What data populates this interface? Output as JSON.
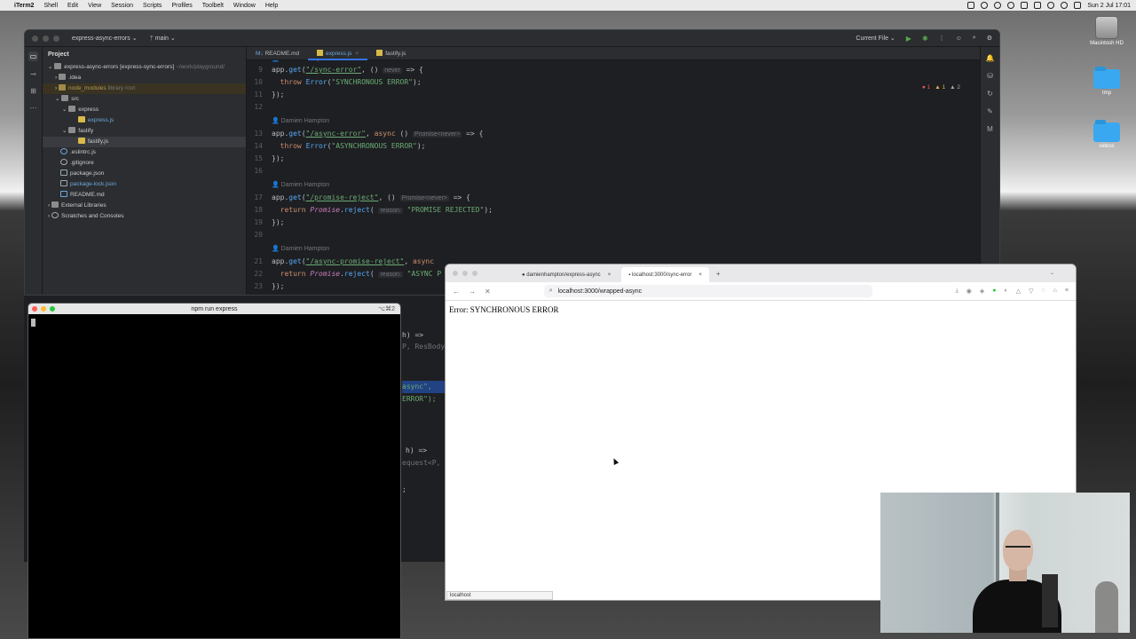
{
  "menubar": {
    "app": "iTerm2",
    "items": [
      "Shell",
      "Edit",
      "View",
      "Session",
      "Scripts",
      "Profiles",
      "Toolbelt",
      "Window",
      "Help"
    ],
    "datetime": "Sun 2 Jul  17:01"
  },
  "desktop": {
    "icons": [
      {
        "label": "Macintosh HD",
        "kind": "disk-icon"
      },
      {
        "label": "tmp",
        "kind": "folder-icon"
      },
      {
        "label": "videos",
        "kind": "folder-icon"
      }
    ]
  },
  "ide": {
    "project": "express-async-errors",
    "branch": "main",
    "run_config": "Current File",
    "panel_title": "Project",
    "tree": [
      {
        "label": "express-async-errors [express-sync-errors]",
        "suffix": "~/work/playground/",
        "depth": 0,
        "kind": "folder"
      },
      {
        "label": ".idea",
        "depth": 1,
        "kind": "folder"
      },
      {
        "label": "node_modules",
        "suffix": "library root",
        "depth": 1,
        "kind": "folder",
        "style": "yellow"
      },
      {
        "label": "src",
        "depth": 1,
        "kind": "folder"
      },
      {
        "label": "express",
        "depth": 2,
        "kind": "folder"
      },
      {
        "label": "express.js",
        "depth": 3,
        "kind": "js",
        "style": "blue"
      },
      {
        "label": "fastify",
        "depth": 2,
        "kind": "folder"
      },
      {
        "label": "fastify.js",
        "depth": 3,
        "kind": "js",
        "selected": true
      },
      {
        "label": ".eslintrc.js",
        "depth": 1,
        "kind": "js"
      },
      {
        "label": ".gitignore",
        "depth": 1,
        "kind": "file"
      },
      {
        "label": "package.json",
        "depth": 1,
        "kind": "json"
      },
      {
        "label": "package-lock.json",
        "depth": 1,
        "kind": "json",
        "style": "blue"
      },
      {
        "label": "README.md",
        "depth": 1,
        "kind": "file"
      },
      {
        "label": "External Libraries",
        "depth": 0,
        "kind": "folder"
      },
      {
        "label": "Scratches and Consoles",
        "depth": 0,
        "kind": "file"
      }
    ],
    "tabs": [
      {
        "label": "README.md",
        "prefix": "M↓"
      },
      {
        "label": "express.js",
        "active": true
      },
      {
        "label": "fastify.js"
      }
    ],
    "inspections": {
      "errors": "1",
      "warnings": "1",
      "weak": "2"
    },
    "author": "Damien Hampton",
    "code": {
      "l9": "9",
      "l10": "10",
      "l11": "11",
      "l12": "12",
      "l13": "13",
      "l14": "14",
      "l15": "15",
      "l16": "16",
      "l17": "17",
      "l18": "18",
      "l19": "19",
      "l20": "20",
      "l21": "21",
      "l22": "22",
      "l23": "23",
      "route1": "\"/sync-error\"",
      "route2": "\"/async-error\"",
      "route3": "\"/promise-reject\"",
      "route4": "\"/async-promise-reject\"",
      "msg1": "\"SYNCHRONOUS ERROR\"",
      "msg2": "\"ASYNCHRONOUS ERROR\"",
      "msg3": "\"PROMISE REJECTED\"",
      "msg4": "\"ASYNC P",
      "hint_never": "never",
      "hint_promise": "Promise<never>",
      "hint_reason": "reason:"
    },
    "peek": {
      "p1": "h) =>",
      "p2": "P, ResBody",
      "p3": "async\",",
      "p4": "ERROR\");",
      "p5": "h) =>",
      "p6": "equest<P, R",
      "p7": ";"
    }
  },
  "terminal": {
    "title": "npm run express",
    "shortcut": "⌥⌘2"
  },
  "browser": {
    "tabs": [
      {
        "label": "damienhampton/express-async"
      },
      {
        "label": "localhost:3000/sync-error",
        "active": true
      }
    ],
    "url": "localhost:3000/wrapped-async",
    "content": "Error: SYNCHRONOUS ERROR",
    "status": "localhost"
  }
}
